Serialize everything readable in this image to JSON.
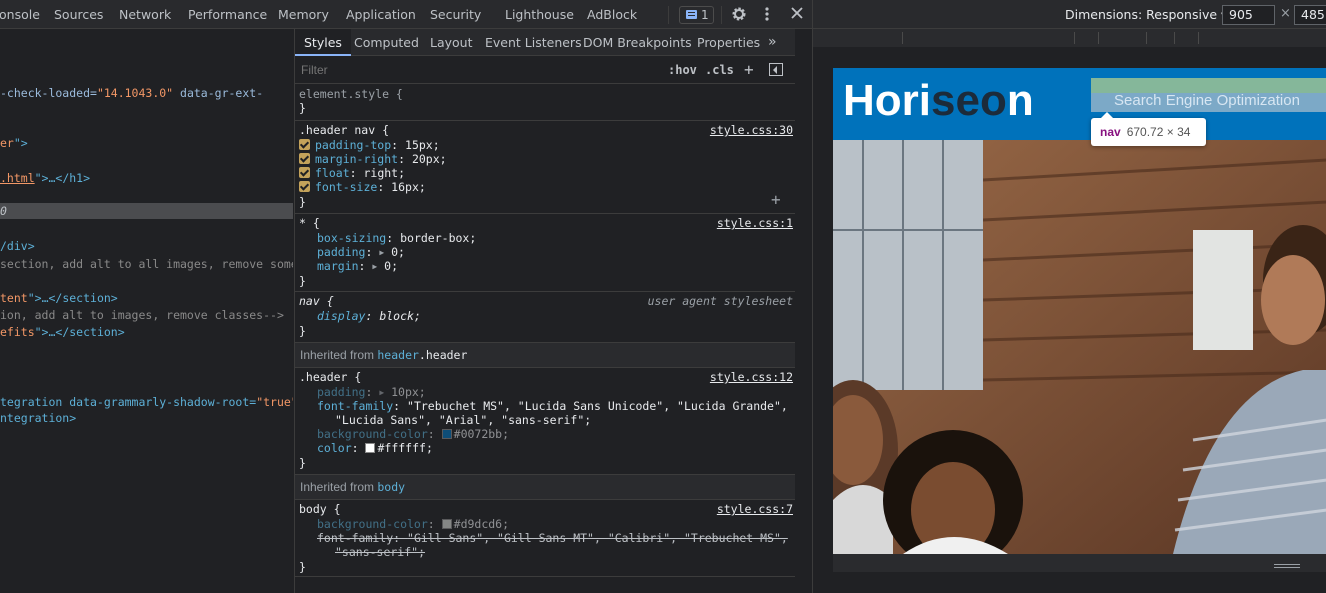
{
  "devtools": {
    "tabs": [
      "onsole",
      "Sources",
      "Network",
      "Performance",
      "Memory",
      "Application",
      "Security",
      "Lighthouse",
      "AdBlock"
    ],
    "messages_count": "1"
  },
  "elements": {
    "lines": [
      {
        "p1": "-check-loaded=",
        "p2": "\"14.1043.0\"",
        "p3": " data-gr-ext-"
      },
      {
        "p1": "er",
        "p2": "\">",
        "p3": ""
      },
      {
        "p1": ".html",
        "p2": "\">",
        "p3": "…</h1>"
      },
      {
        "p1": "0",
        "p2": "",
        "p3": ""
      },
      {
        "p1": "/div>",
        "p2": "",
        "p3": ""
      },
      {
        "p1": "section, add alt to all images, remove some",
        "p2": "",
        "p3": ""
      },
      {
        "p1": "tent",
        "p2": "\">",
        "p3": "…</section>"
      },
      {
        "p1": "ion, add alt to images, remove classes-->",
        "p2": "",
        "p3": ""
      },
      {
        "p1": "efits",
        "p2": "\">",
        "p3": "…</section>"
      },
      {
        "p1": "tegration data-grammarly-shadow-root=",
        "p2": "\"true\"",
        "p3": ">"
      },
      {
        "p1": "ntegration>",
        "p2": "",
        "p3": ""
      }
    ]
  },
  "styles": {
    "tabs": [
      "Styles",
      "Computed",
      "Layout",
      "Event Listeners",
      "DOM Breakpoints",
      "Properties"
    ],
    "more": "»",
    "filter_placeholder": "Filter",
    "hov": ":hov",
    "cls": ".cls",
    "element_style": "element.style {",
    "close": "}",
    "rule_header_nav": {
      "selector": ".header nav {",
      "source": "style.css:30",
      "props": [
        {
          "name": "padding-top",
          "value": "15px;"
        },
        {
          "name": "margin-right",
          "value": "20px;"
        },
        {
          "name": "float",
          "value": "right;"
        },
        {
          "name": "font-size",
          "value": "16px;"
        }
      ]
    },
    "rule_star": {
      "selector": "* {",
      "source": "style.css:1",
      "props": [
        {
          "name": "box-sizing",
          "value": "border-box;"
        },
        {
          "name": "padding",
          "value": "0;"
        },
        {
          "name": "margin",
          "value": "0;"
        }
      ]
    },
    "rule_nav": {
      "selector": "nav {",
      "source": "user agent stylesheet",
      "prop_name": "display",
      "prop_value": "block;"
    },
    "inherited_header": {
      "label": "Inherited from ",
      "selector_tag": "header",
      "selector_class": ".header"
    },
    "rule_header": {
      "selector": ".header {",
      "source": "style.css:12",
      "padding_name": "padding",
      "padding_value": "10px;",
      "font_family_name": "font-family",
      "font_family_value1": "\"Trebuchet MS\", \"Lucida Sans Unicode\", \"Lucida Grande\",",
      "font_family_value2": "\"Lucida Sans\", \"Arial\", \"sans-serif\";",
      "bg_name": "background-color",
      "bg_value": "#0072bb;",
      "color_name": "color",
      "color_value": "#ffffff;"
    },
    "inherited_body": {
      "label": "Inherited from ",
      "selector": "body"
    },
    "rule_body": {
      "selector": "body {",
      "source": "style.css:7",
      "bg_name": "background-color",
      "bg_value": "#d9dcd6;",
      "ff_name": "font-family",
      "ff_value1": "\"Gill Sans\", \"Gill Sans MT\", \"Calibri\", \"Trebuchet MS\",",
      "ff_value2": "\"sans-serif\";"
    }
  },
  "device": {
    "dimensions_label": "Dimensions: Responsive",
    "width": "905",
    "times": "×",
    "height": "485",
    "site": {
      "logo_a": "Hori",
      "logo_b": "seo",
      "logo_c": "n",
      "nav_text": "Search Engine Optimization",
      "tooltip_name": "nav",
      "tooltip_size": "670.72 × 34"
    }
  },
  "colors": {
    "header_blue": "#0072bb",
    "body_bg": "#d9dcd6",
    "accent": "#8ab4f8"
  }
}
